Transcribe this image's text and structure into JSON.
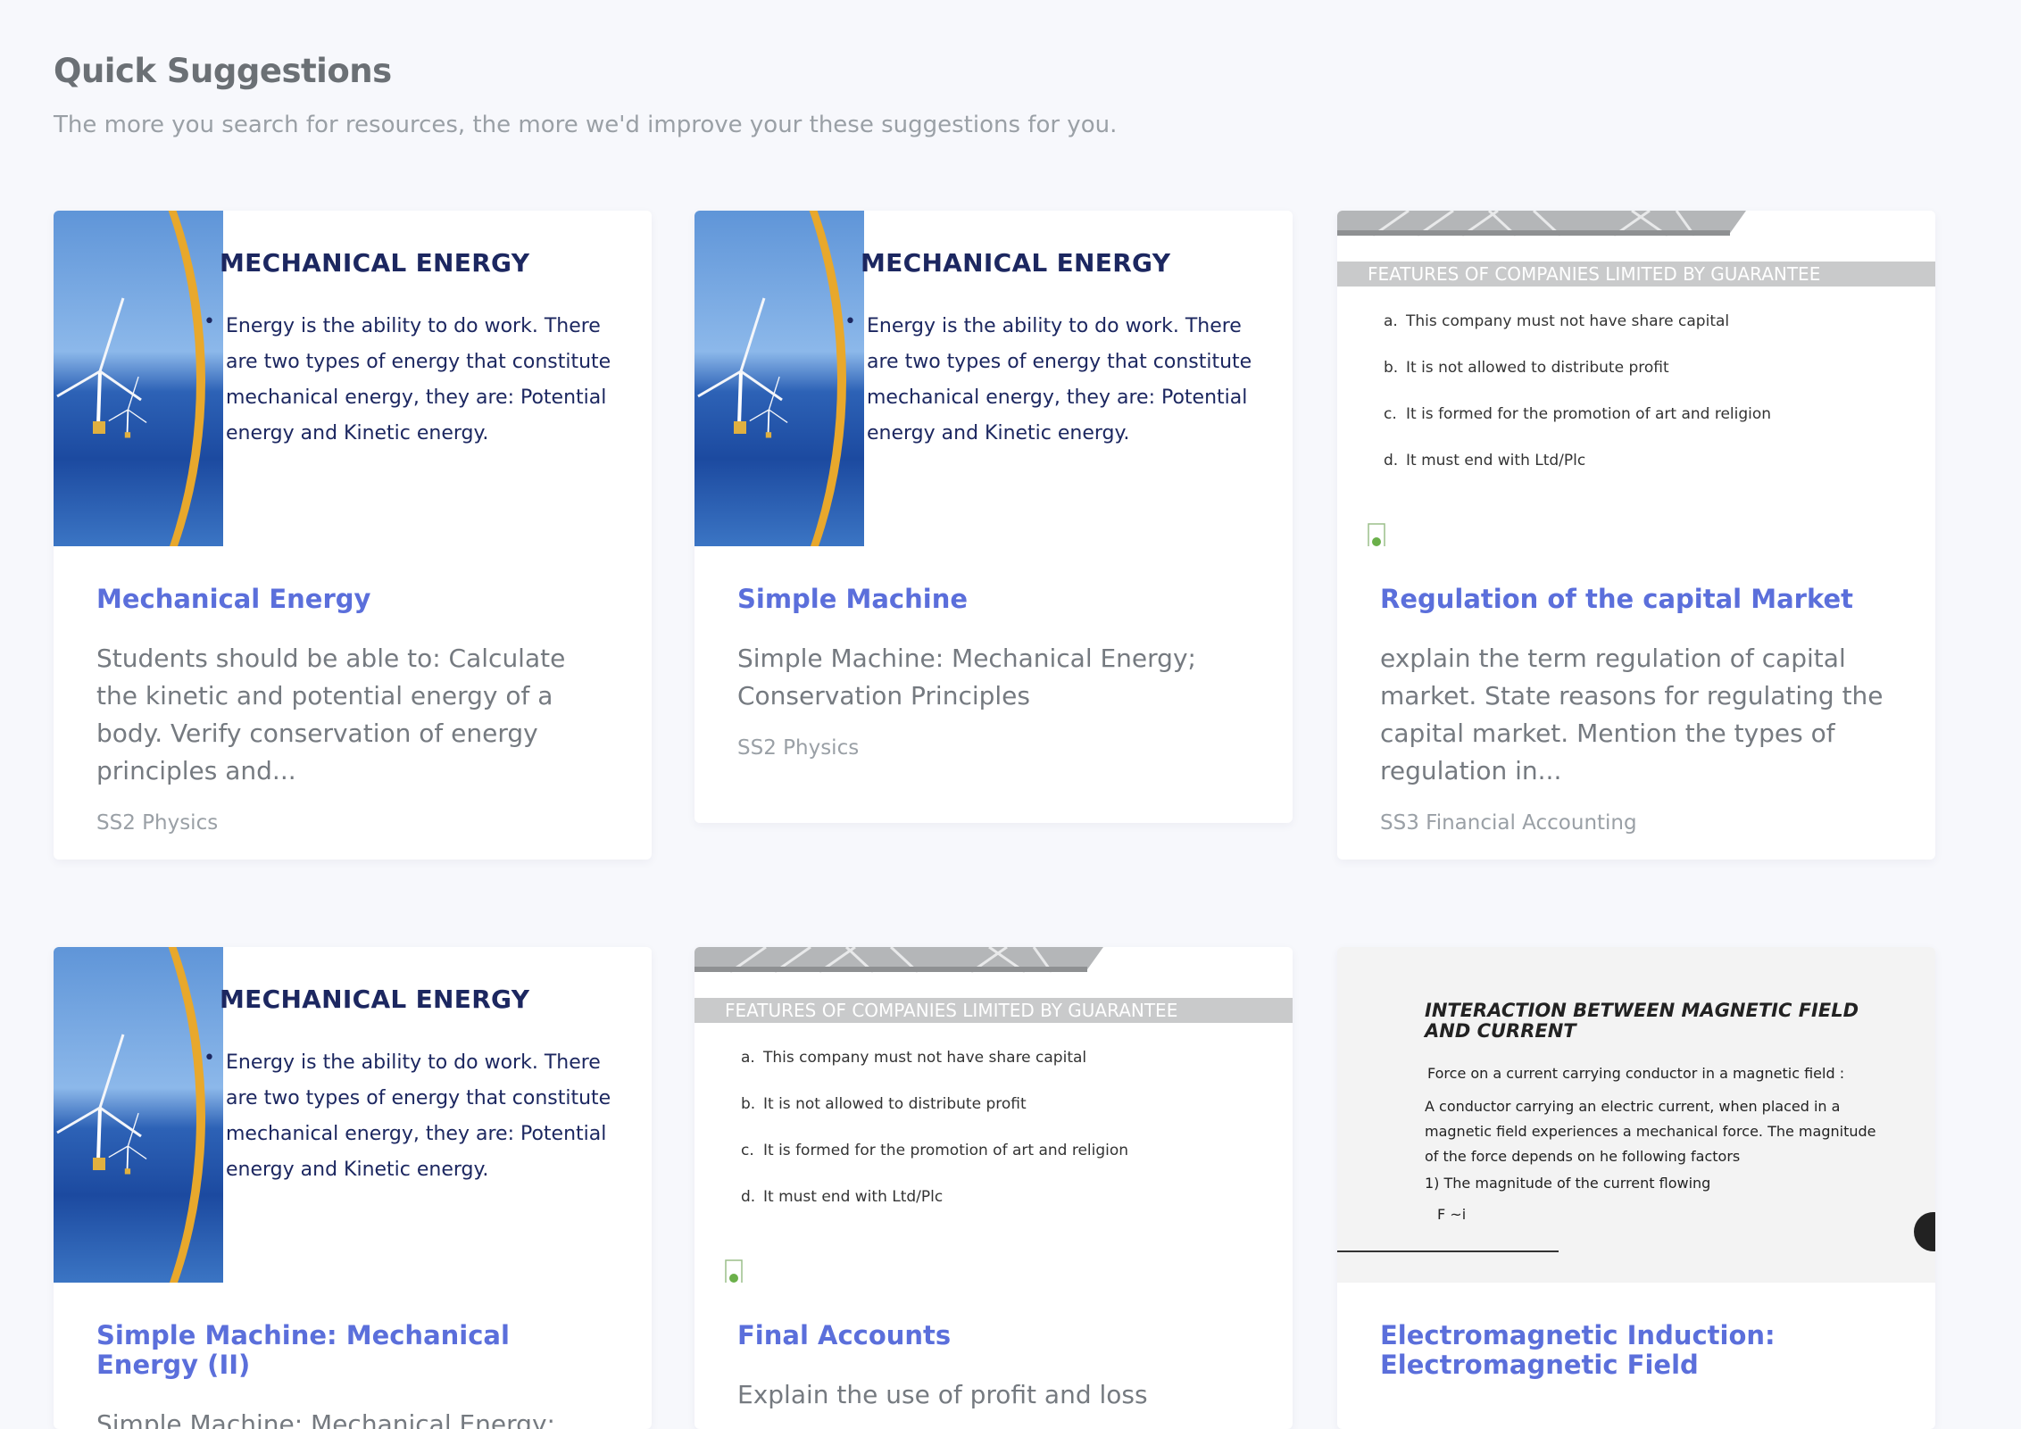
{
  "section": {
    "title": "Quick Suggestions",
    "subtitle": "The more you search for resources, the more we'd improve your these suggestions for you."
  },
  "energy_slide": {
    "title": "MECHANICAL ENERGY",
    "bullet": "Energy is the ability to do work. There are two types of energy that constitute mechanical energy, they are: Potential energy and Kinetic energy."
  },
  "company_slide": {
    "title": "FEATURES OF COMPANIES LIMITED BY GUARANTEE",
    "items": [
      {
        "letter": "a.",
        "text": "This company must not have share capital"
      },
      {
        "letter": "b.",
        "text": "It is not allowed to distribute profit"
      },
      {
        "letter": "c.",
        "text": "It is formed for the promotion of art and religion"
      },
      {
        "letter": "d.",
        "text": "It must end with Ltd/Plc"
      }
    ]
  },
  "magnetic_slide": {
    "title": "INTERACTION BETWEEN MAGNETIC FIELD AND CURRENT",
    "line1": "Force on a current carrying conductor in a magnetic field :",
    "line2": "A conductor carrying an electric current, when placed in a magnetic field experiences a mechanical force. The magnitude of the force depends on he following factors",
    "line3": "1) The magnitude of the current flowing",
    "line4": "F ~i"
  },
  "cards": [
    {
      "title": "Mechanical Energy",
      "description": "Students should be able to: Calculate the kinetic and potential energy of a body. Verify conservation of energy principles and...",
      "subject": "SS2 Physics"
    },
    {
      "title": "Simple Machine",
      "description": "Simple Machine: Mechanical Energy; Conservation Principles",
      "subject": "SS2 Physics"
    },
    {
      "title": "Regulation of the capital Market",
      "description": "explain the term regulation of capital market. State reasons for regulating the capital market. Mention the types of regulation in...",
      "subject": "SS3 Financial Accounting"
    },
    {
      "title": "Simple Machine: Mechanical Energy (II)",
      "description": "Simple Machine: Mechanical Energy;",
      "subject": ""
    },
    {
      "title": "Final Accounts",
      "description": "Explain the use of profit and loss",
      "subject": ""
    },
    {
      "title": "Electromagnetic Induction: Electromagnetic Field",
      "description": "",
      "subject": ""
    }
  ]
}
